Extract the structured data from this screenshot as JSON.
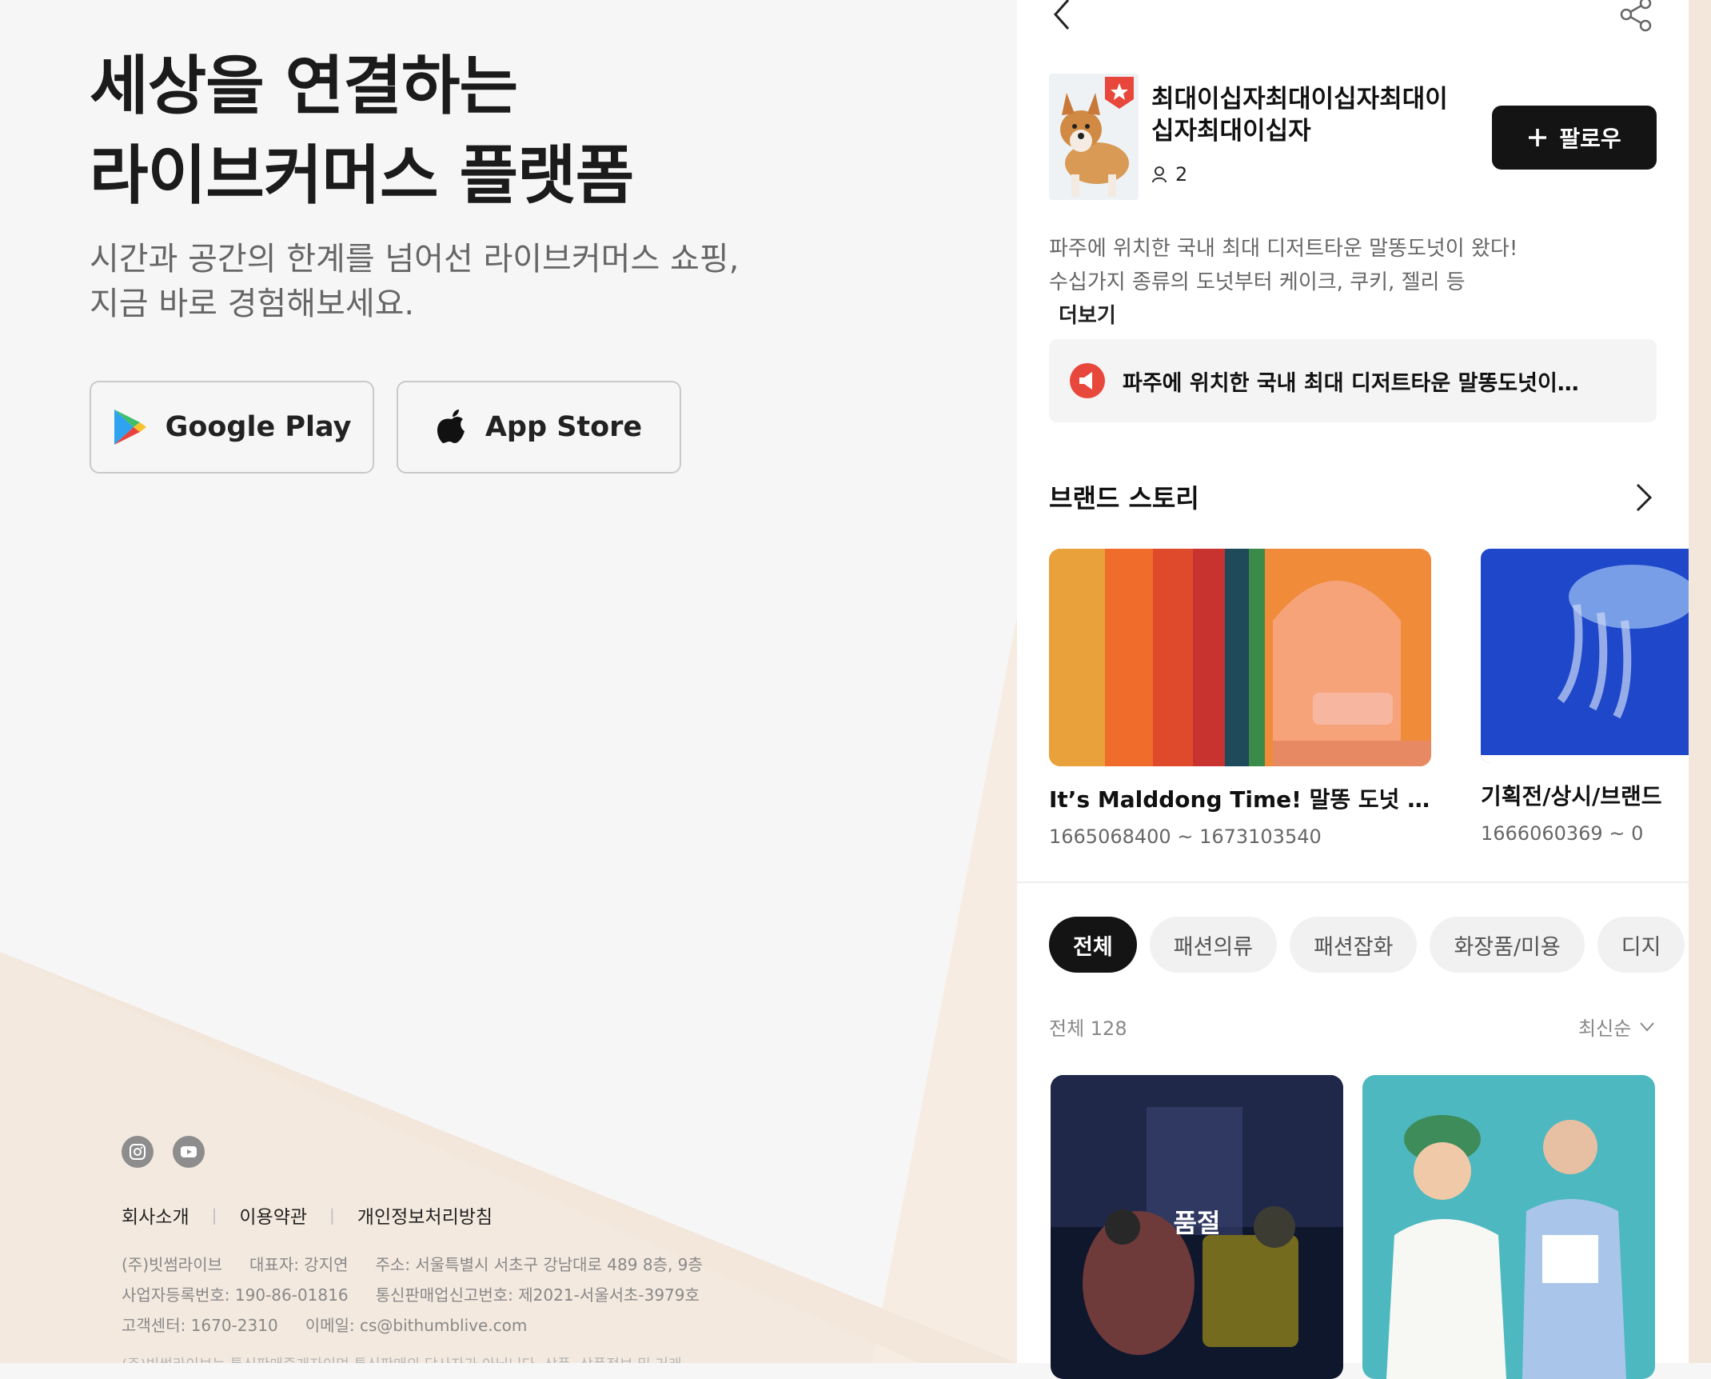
{
  "hero": {
    "title_line1": "세상을 연결하는",
    "title_line2": "라이브커머스 플랫폼",
    "subtitle_line1": "시간과 공간의 한계를 넘어선 라이브커머스 쇼핑,",
    "subtitle_line2": "지금 바로 경험해보세요."
  },
  "stores": {
    "google_play": "Google Play",
    "app_store": "App Store"
  },
  "footer": {
    "social": [
      "instagram-icon",
      "youtube-icon"
    ],
    "links": [
      "회사소개",
      "이용약관",
      "개인정보처리방침"
    ],
    "company": "(주)빗썸라이브",
    "ceo": "대표자: 강지연",
    "address": "주소: 서울특별시 서초구 강남대로 489 8층, 9층",
    "biz_reg": "사업자등록번호: 190-86-01816",
    "mail_order": "통신판매업신고번호: 제2021-서울서초-3979호",
    "cs": "고객센터: 1670-2310",
    "email": "이메일: cs@bithumblive.com",
    "disclaimer": "(주)빗썸라이브는 통신판매중개자이며 통신판매의 당사자가 아닙니다. 상품, 상품정보 및 거래"
  },
  "shop": {
    "name_line1": "최대이십자최대이십자최대이",
    "name_line2": "십자최대이십자",
    "followers": "2",
    "follow_label": "팔로우",
    "desc_line1": "파주에 위치한 국내 최대 디저트타운 말똥도넛이 왔다!",
    "desc_line2": "수십가지 종류의 도넛부터 케이크, 쿠키, 젤리 등",
    "more_label": "더보기",
    "notice": "파주에 위치한 국내 최대 디저트타운 말똥도넛이…"
  },
  "brand_story": {
    "title": "브랜드 스토리",
    "items": [
      {
        "title": "It’s Malddong Time! 말똥 도넛 디저…",
        "dates": "1665068400 ~ 1673103540"
      },
      {
        "title": "기획전/상시/브랜드",
        "dates": "1666060369 ~ 0"
      }
    ]
  },
  "categories": [
    "전체",
    "패션의류",
    "패션잡화",
    "화장품/미용",
    "디지"
  ],
  "products_header": {
    "count_label": "전체 128",
    "sort_label": "최신순"
  },
  "products": [
    {
      "status": "품절"
    },
    {
      "status": ""
    }
  ],
  "colors": {
    "accent_red": "#e8473c",
    "dark": "#141414",
    "page_bg": "#f6f6f6",
    "beige": "#f3e7dc"
  }
}
